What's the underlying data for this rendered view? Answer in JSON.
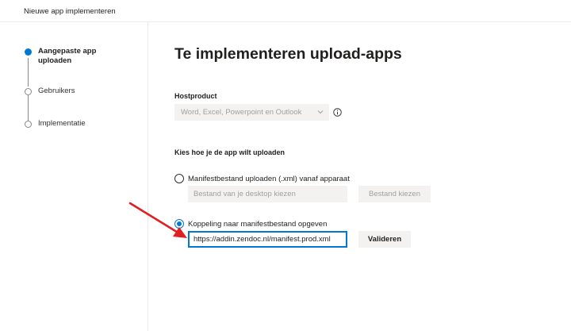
{
  "window": {
    "title": "Nieuwe app implementeren"
  },
  "steps": [
    {
      "label": "Aangepaste app uploaden",
      "state": "active"
    },
    {
      "label": "Gebruikers",
      "state": "inactive"
    },
    {
      "label": "Implementatie",
      "state": "inactive"
    }
  ],
  "main": {
    "title": "Te implementeren upload-apps",
    "host_product": {
      "label": "Hostproduct",
      "value": "Word, Excel, Powerpoint en Outlook"
    },
    "upload_method": {
      "label": "Kies hoe je de app wilt uploaden",
      "option_file": {
        "label": "Manifestbestand uploaden (.xml) vanaf apparaat",
        "placeholder": "Bestand van je desktop kiezen",
        "button": "Bestand kiezen",
        "selected": false
      },
      "option_link": {
        "label": "Koppeling naar manifestbestand opgeven",
        "value": "https://addin.zendoc.nl/manifest.prod.xml",
        "button": "Valideren",
        "selected": true
      }
    }
  },
  "icons": {
    "info": "info-icon",
    "chevron": "chevron-down-icon",
    "annotation": "red-arrow-icon"
  },
  "colors": {
    "accent": "#0078d4",
    "arrow": "#e02020",
    "disabled_bg": "#f3f2f1",
    "disabled_text": "#a19f9d"
  }
}
